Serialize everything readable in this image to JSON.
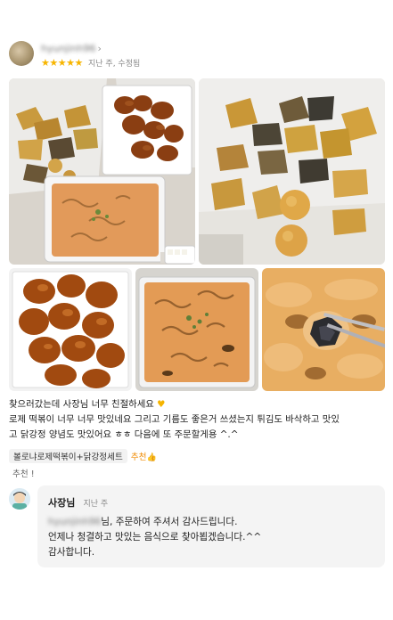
{
  "review": {
    "username": "hyunjinh96",
    "username_chevron": "›",
    "stars": "★★★★★",
    "meta": "지난 주, 수정됨",
    "body_line1": "찾으러갔는데 사장님 너무 친절하세요",
    "heart": "♥",
    "body_line2": "로제 떡볶이 너무 너무 맛있네요 그리고 기름도 좋은거 쓰셨는지 튀김도 바삭하고 맛있",
    "body_line3": "고 닭강정 양념도 맛있어요 ㅎㅎ 다음에 또 주문할게용 ^.^",
    "menu_item": "볼로냐로제떡볶이+닭강정세트",
    "recommend_label": "추천",
    "thumb": "👍",
    "recommend_line": "추천 !"
  },
  "owner_reply": {
    "name": "사장님",
    "time": "지난 주",
    "customer_name": "hyunjinh96",
    "line1_suffix": "님, 주문하여 주셔서 감사드립니다.",
    "line2": "언제나 청결하고 맛있는 음식으로 찾아뵙겠습니다.^^",
    "line3": "감사합니다."
  },
  "colors": {
    "star": "#f7b500",
    "recommend": "#f08a00",
    "bubble": "#f4f4f4"
  }
}
